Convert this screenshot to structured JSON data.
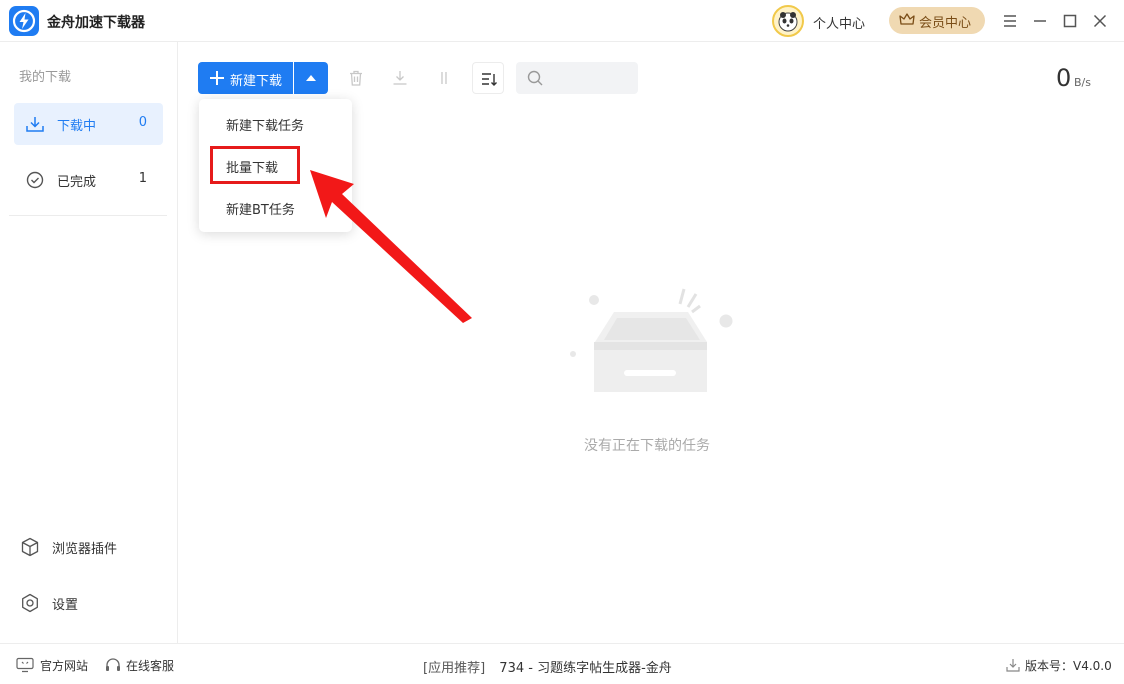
{
  "app": {
    "title": "金舟加速下载器",
    "accent_color": "#1f7cf2"
  },
  "titlebar": {
    "profile_label": "个人中心",
    "vip_label": "会员中心",
    "menu_icon": "menu-icon",
    "minimize_icon": "minimize-icon",
    "maximize_icon": "maximize-icon",
    "close_icon": "close-icon"
  },
  "sidebar": {
    "heading": "我的下载",
    "items": [
      {
        "label": "下载中",
        "count": "0",
        "icon": "download-icon",
        "active": true
      },
      {
        "label": "已完成",
        "count": "1",
        "icon": "check-circle-icon",
        "active": false
      }
    ],
    "bottom": [
      {
        "label": "浏览器插件",
        "icon": "cube-icon"
      },
      {
        "label": "设置",
        "icon": "gear-icon"
      }
    ]
  },
  "toolbar": {
    "new_download_label": "新建下载",
    "search_placeholder": "",
    "speed_value": "0",
    "speed_unit": "B/s"
  },
  "dropdown": {
    "items": [
      "新建下载任务",
      "批量下载",
      "新建BT任务"
    ],
    "highlighted": "批量下载",
    "highlight_color": "#e61b1b"
  },
  "empty_state": {
    "message": "没有正在下载的任务"
  },
  "footer": {
    "website_label": "官方网站",
    "support_label": "在线客服",
    "promo_tag": "[应用推荐]",
    "promo_text": "734 - 习题练字帖生成器-金舟",
    "version_label": "版本号：V4.0.0"
  }
}
